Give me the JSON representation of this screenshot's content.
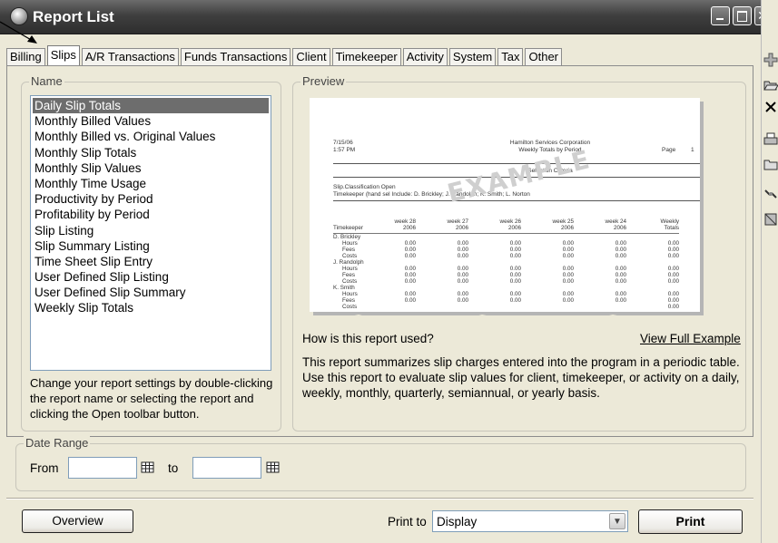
{
  "window": {
    "title": "Report List"
  },
  "tabs": [
    "Billing",
    "Slips",
    "A/R Transactions",
    "Funds Transactions",
    "Client",
    "Timekeeper",
    "Activity",
    "System",
    "Tax",
    "Other"
  ],
  "active_tab": "Slips",
  "name_group": {
    "label": "Name",
    "items": [
      "Daily Slip Totals",
      "Monthly Billed Values",
      "Monthly Billed vs. Original Values",
      "Monthly Slip Totals",
      "Monthly Slip Values",
      "Monthly Time Usage",
      "Productivity by Period",
      "Profitability by Period",
      "Slip Listing",
      "Slip Summary Listing",
      "Time Sheet Slip Entry",
      "User Defined Slip Listing",
      "User Defined Slip Summary",
      "Weekly Slip Totals"
    ],
    "selected": "Daily Slip Totals",
    "hint": "Change your report settings by double-clicking the report name or selecting the report and clicking the Open toolbar button."
  },
  "preview": {
    "label": "Preview",
    "sample": {
      "date": "7/15/06",
      "time": "1:57 PM",
      "company": "Hamilton Services Corporation",
      "report_title": "Weekly Totals by Period",
      "page_label": "Page",
      "page_num": "1",
      "criteria_title": "Selection Criteria",
      "criteria_1": "Slip.Classification    Open",
      "criteria_2": "Timekeeper (hand sel Include: D. Brickley; J. Randolph; K. Smith; L. Norton",
      "watermark": "EXAMPLE",
      "col_headers": [
        "Timekeeper",
        "week 28\n2006",
        "week 27\n2006",
        "week 26\n2006",
        "week 25\n2006",
        "week 24\n2006",
        "Weekly\nTotals"
      ],
      "groups": [
        {
          "name": "D. Brickley",
          "rows": [
            {
              "label": "Hours",
              "values": [
                "0.00",
                "0.00",
                "0.00",
                "0.00",
                "0.00",
                "0.00"
              ]
            },
            {
              "label": "Fees",
              "values": [
                "0.00",
                "0.00",
                "0.00",
                "0.00",
                "0.00",
                "0.00"
              ]
            },
            {
              "label": "Costs",
              "values": [
                "0.00",
                "0.00",
                "0.00",
                "0.00",
                "0.00",
                "0.00"
              ]
            }
          ]
        },
        {
          "name": "J. Randolph",
          "rows": [
            {
              "label": "Hours",
              "values": [
                "0.00",
                "0.00",
                "0.00",
                "0.00",
                "0.00",
                "0.00"
              ]
            },
            {
              "label": "Fees",
              "values": [
                "0.00",
                "0.00",
                "0.00",
                "0.00",
                "0.00",
                "0.00"
              ]
            },
            {
              "label": "Costs",
              "values": [
                "0.00",
                "0.00",
                "0.00",
                "0.00",
                "0.00",
                "0.00"
              ]
            }
          ]
        },
        {
          "name": "K. Smith",
          "rows": [
            {
              "label": "Hours",
              "values": [
                "0.00",
                "0.00",
                "0.00",
                "0.00",
                "0.00",
                "0.00"
              ]
            },
            {
              "label": "Fees",
              "values": [
                "0.00",
                "0.00",
                "0.00",
                "0.00",
                "0.00",
                "0.00"
              ]
            },
            {
              "label": "Costs",
              "values": [
                "",
                "",
                "",
                "",
                "",
                "0.00"
              ]
            }
          ]
        }
      ]
    },
    "question": "How is this report used?",
    "view_full_link": "View Full Example",
    "description": "This report summarizes slip charges entered into the program in a periodic table. Use this report to evaluate slip values for client, timekeeper, or activity on a daily, weekly, monthly, quarterly, semiannual, or yearly basis."
  },
  "date_range": {
    "label": "Date Range",
    "from_label": "From",
    "to_label": "to",
    "from_value": "",
    "to_value": ""
  },
  "footer": {
    "overview_button": "Overview",
    "print_to_label": "Print to",
    "print_to_value": "Display",
    "print_button": "Print"
  },
  "toolbar_icons": [
    "add-icon",
    "open-folder-icon",
    "delete-icon",
    "print-setup-icon",
    "folder-icon",
    "link-icon",
    "report-icon"
  ]
}
